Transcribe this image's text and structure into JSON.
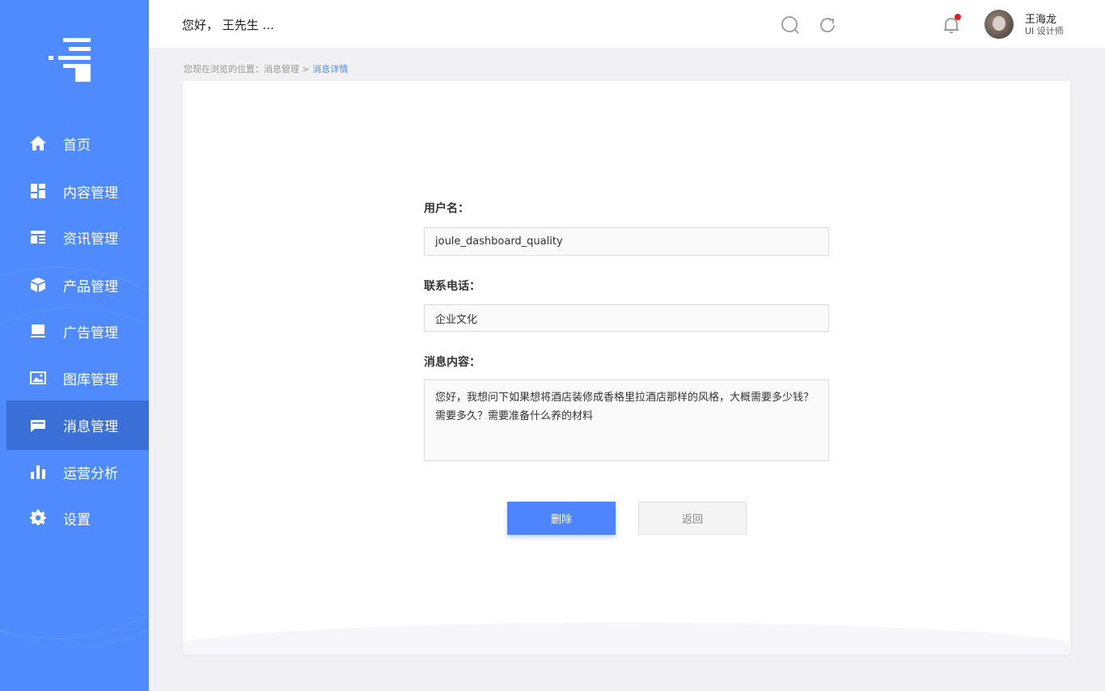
{
  "sidebar": {
    "items": [
      {
        "label": "首页",
        "icon": "home-icon"
      },
      {
        "label": "内容管理",
        "icon": "dashboard-icon"
      },
      {
        "label": "资讯管理",
        "icon": "news-icon"
      },
      {
        "label": "产品管理",
        "icon": "box-icon"
      },
      {
        "label": "广告管理",
        "icon": "monitor-icon"
      },
      {
        "label": "图库管理",
        "icon": "image-icon"
      },
      {
        "label": "消息管理",
        "icon": "message-icon"
      },
      {
        "label": "运营分析",
        "icon": "bar-chart-icon"
      },
      {
        "label": "设置",
        "icon": "gear-icon"
      }
    ],
    "active_index": 6
  },
  "header": {
    "greeting": "您好， 王先生 ...",
    "user_name": "王海龙",
    "user_role": "UI 设计师",
    "has_notification": true
  },
  "breadcrumb": {
    "prefix": "您现在浏览的位置：消息管理",
    "separator": " > ",
    "current": "消息详情"
  },
  "form": {
    "username_label": "用户名：",
    "username_value": "joule_dashboard_quality",
    "phone_label": "联系电话：",
    "phone_value": "企业文化",
    "content_label": "消息内容：",
    "content_value": "您好，我想问下如果想将酒店装修成香格里拉酒店那样的风格，大概需要多少钱？需要多久？需要准备什么养的材料"
  },
  "actions": {
    "delete_label": "删除",
    "back_label": "返回"
  },
  "colors": {
    "sidebar": "#4f8bfd",
    "sidebar_active": "#3a6fd8",
    "primary_button": "#4f84ff",
    "breadcrumb_current": "#4f8bfd",
    "notification_dot": "#e02020"
  }
}
